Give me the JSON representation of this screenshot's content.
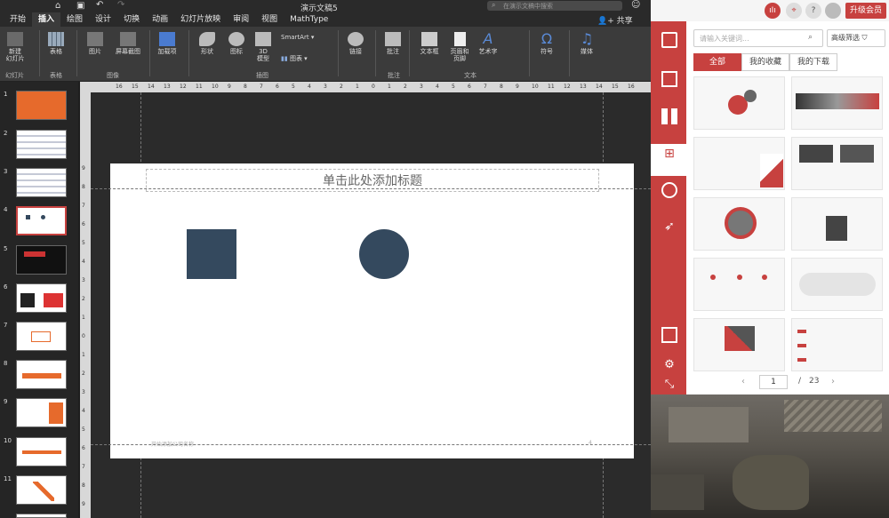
{
  "app": {
    "doc_title": "演示文稿5",
    "search_placeholder": "在演示文稿中搜索"
  },
  "tabs": [
    "开始",
    "插入",
    "绘图",
    "设计",
    "切换",
    "动画",
    "幻灯片放映",
    "审阅",
    "视图",
    "MathType"
  ],
  "share": "共享",
  "ribbon": {
    "buttons": [
      "新建\n幻灯片",
      "表格",
      "图片",
      "屏幕截图",
      "加载项",
      "形状",
      "图标",
      "3D\n模型",
      "SmartArt",
      "图表",
      "链接",
      "批注",
      "文本框",
      "页眉和\n页脚",
      "艺术字",
      "符号",
      "媒体"
    ],
    "groups": [
      "幻灯片",
      "表格",
      "图像",
      "插图",
      "批注",
      "文本"
    ]
  },
  "ruler": {
    "h": [
      "16",
      "15",
      "14",
      "13",
      "12",
      "11",
      "10",
      "9",
      "8",
      "7",
      "6",
      "5",
      "4",
      "3",
      "2",
      "1",
      "0",
      "1",
      "2",
      "3",
      "4",
      "5",
      "6",
      "7",
      "8",
      "9",
      "10",
      "11",
      "12",
      "13",
      "14",
      "15",
      "16"
    ],
    "v": [
      "9",
      "8",
      "7",
      "6",
      "5",
      "4",
      "3",
      "2",
      "1",
      "0",
      "1",
      "2",
      "3",
      "4",
      "5",
      "6",
      "7",
      "8",
      "9"
    ]
  },
  "slides": [
    "1",
    "2",
    "3",
    "4",
    "5",
    "6",
    "7",
    "8",
    "9",
    "10",
    "11"
  ],
  "slide": {
    "title_placeholder": "单击此处添加标题",
    "footer": "开始添加公司名称",
    "page_num": "4",
    "shape_color": "#34495e"
  },
  "plugin": {
    "top": {
      "vip": "升级会员",
      "help": "?"
    },
    "search_placeholder": "请输入关键词...",
    "advanced": "高级筛选",
    "tabs": [
      "全部",
      "我的收藏",
      "我的下载"
    ],
    "page": {
      "current": "1",
      "sep": "/",
      "total": "23"
    },
    "accent": "#c7413f"
  }
}
